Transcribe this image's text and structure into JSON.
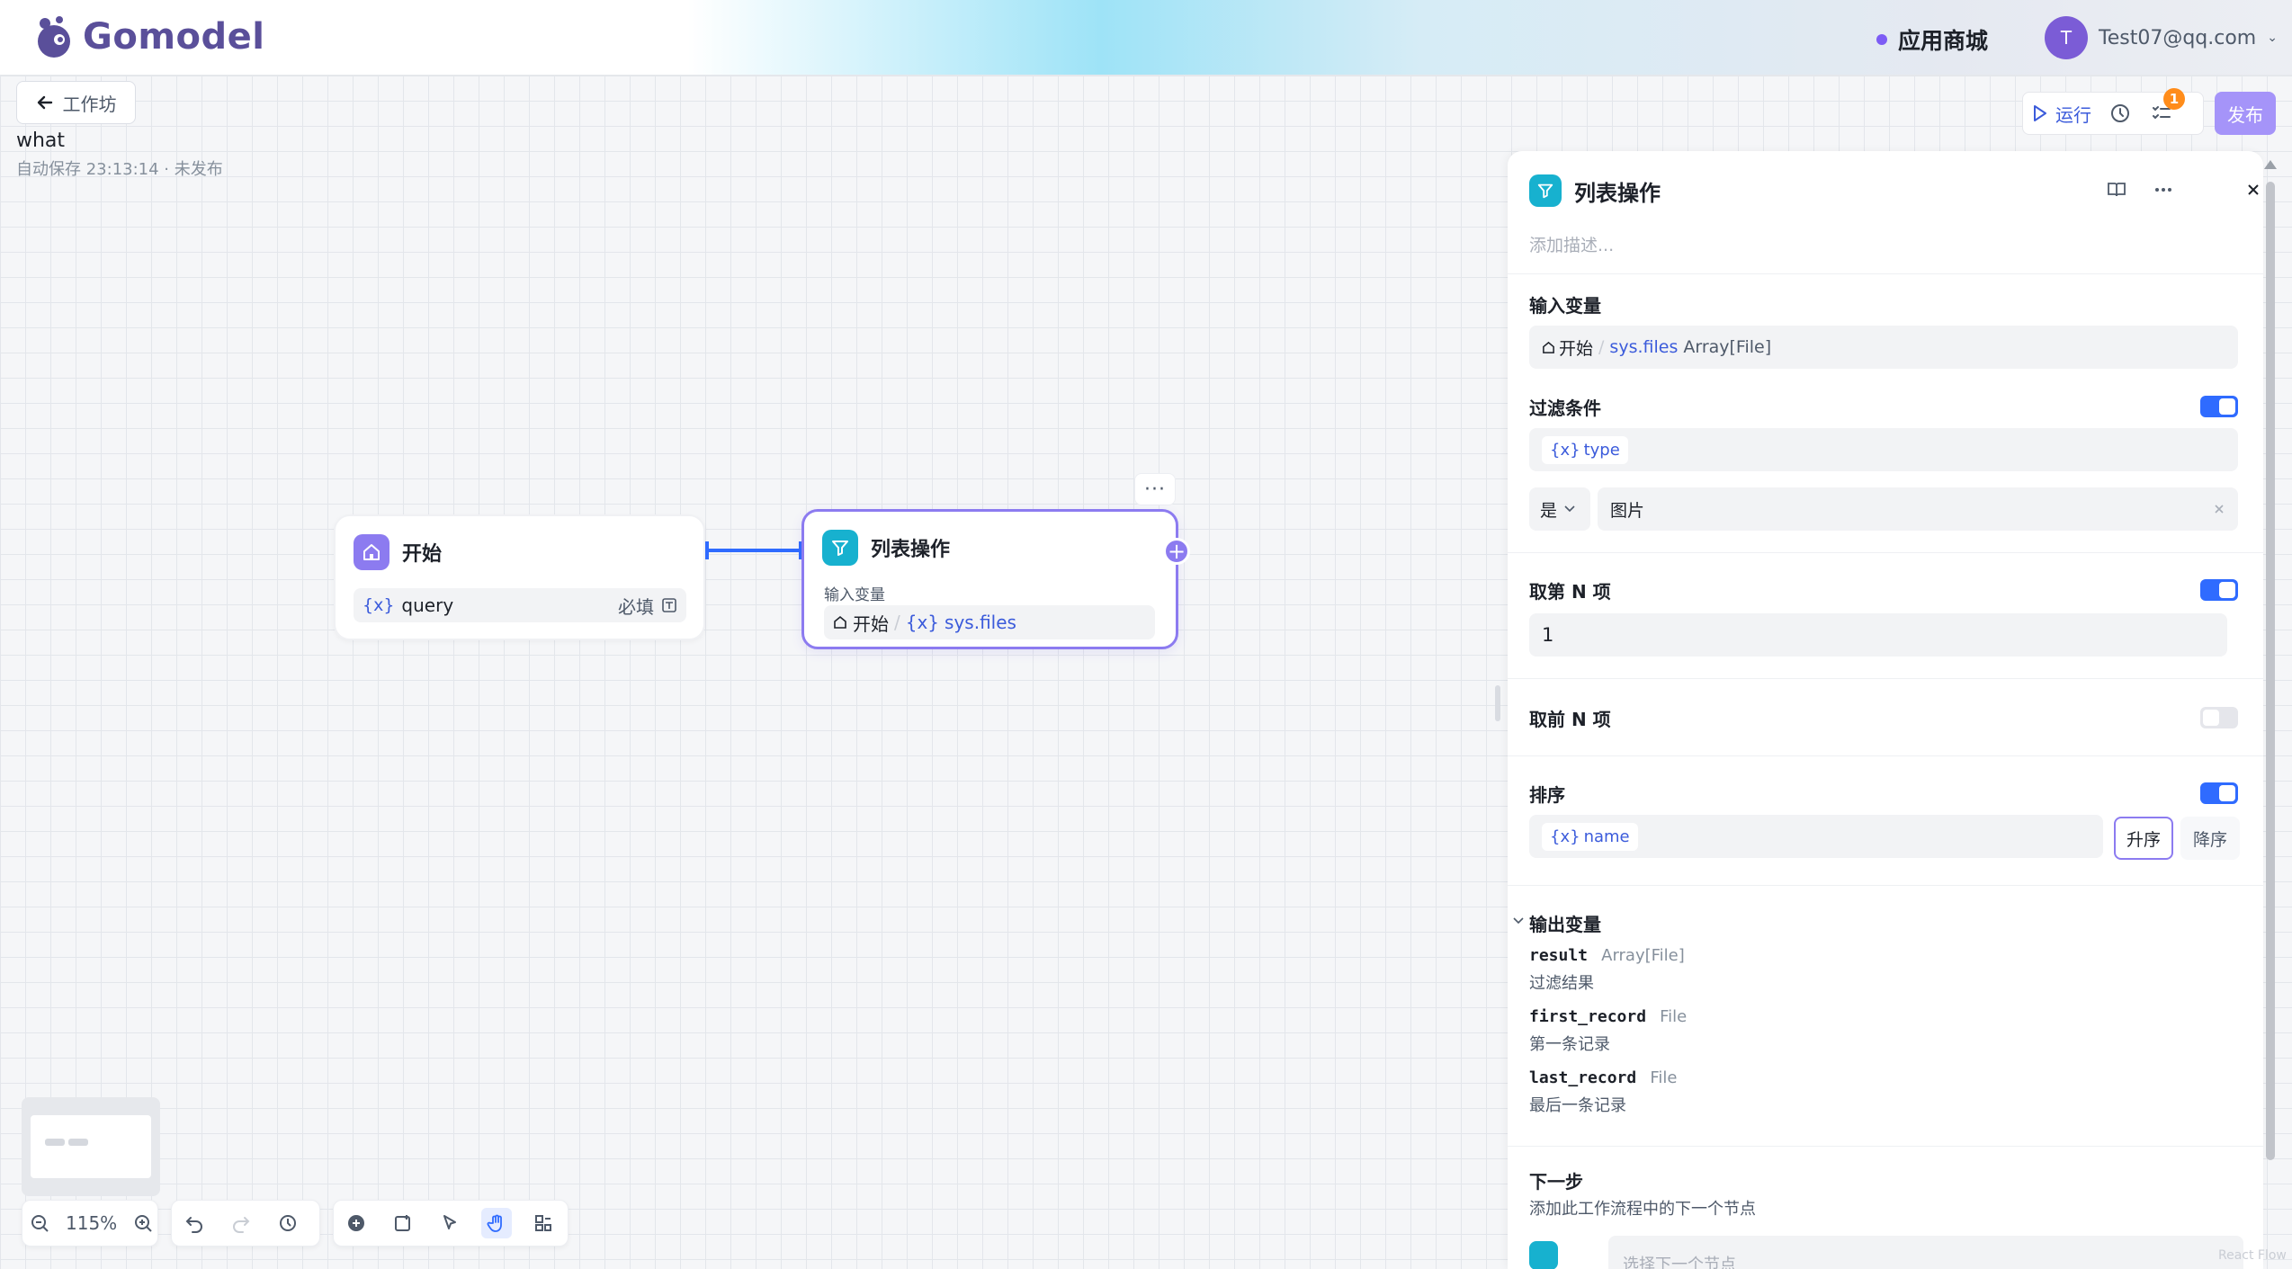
{
  "header": {
    "logo_text": "Gomodel",
    "store_label": "应用商城",
    "user": {
      "avatar_initial": "T",
      "email": "Test07@qq.com"
    }
  },
  "workflow": {
    "back_label": "工作坊",
    "name": "what",
    "status": "自动保存 23:13:14 · 未发布"
  },
  "actions": {
    "run_label": "运行",
    "notice_count": "1",
    "publish_label": "发布"
  },
  "nodes": {
    "start": {
      "title": "开始",
      "var_icon": "{x}",
      "var_name": "query",
      "required_label": "必填"
    },
    "list": {
      "title": "列表操作",
      "input_label": "输入变量",
      "source": "开始",
      "var_icon": "{x}",
      "var_name": "sys.files"
    }
  },
  "canvas_toolbar": {
    "zoom": "115%"
  },
  "panel": {
    "title": "列表操作",
    "desc_placeholder": "添加描述...",
    "input": {
      "label": "输入变量",
      "source": "开始",
      "var": "sys.files",
      "type": "Array[File]"
    },
    "filter": {
      "label": "过滤条件",
      "enabled": true,
      "var": "type",
      "operator": "是",
      "value": "图片"
    },
    "nth": {
      "label": "取第 N 项",
      "enabled": true,
      "value": "1"
    },
    "top_n": {
      "label": "取前 N 项",
      "enabled": false
    },
    "sort": {
      "label": "排序",
      "enabled": true,
      "var": "name",
      "asc_label": "升序",
      "desc_label": "降序",
      "selected": "升序"
    },
    "output": {
      "label": "输出变量",
      "items": [
        {
          "name": "result",
          "type": "Array[File]",
          "desc": "过滤结果"
        },
        {
          "name": "first_record",
          "type": "File",
          "desc": "第一条记录"
        },
        {
          "name": "last_record",
          "type": "File",
          "desc": "最后一条记录"
        }
      ]
    },
    "next": {
      "title": "下一步",
      "desc": "添加此工作流程中的下一个节点",
      "placeholder": "选择下一个节点"
    }
  },
  "watermark": "React Flow",
  "colors": {
    "accent": "#2f6bff",
    "brand_purple": "#8c7bf0",
    "teal": "#17b1cf",
    "publish": "#a594f9",
    "badge": "#ff8c1a"
  }
}
